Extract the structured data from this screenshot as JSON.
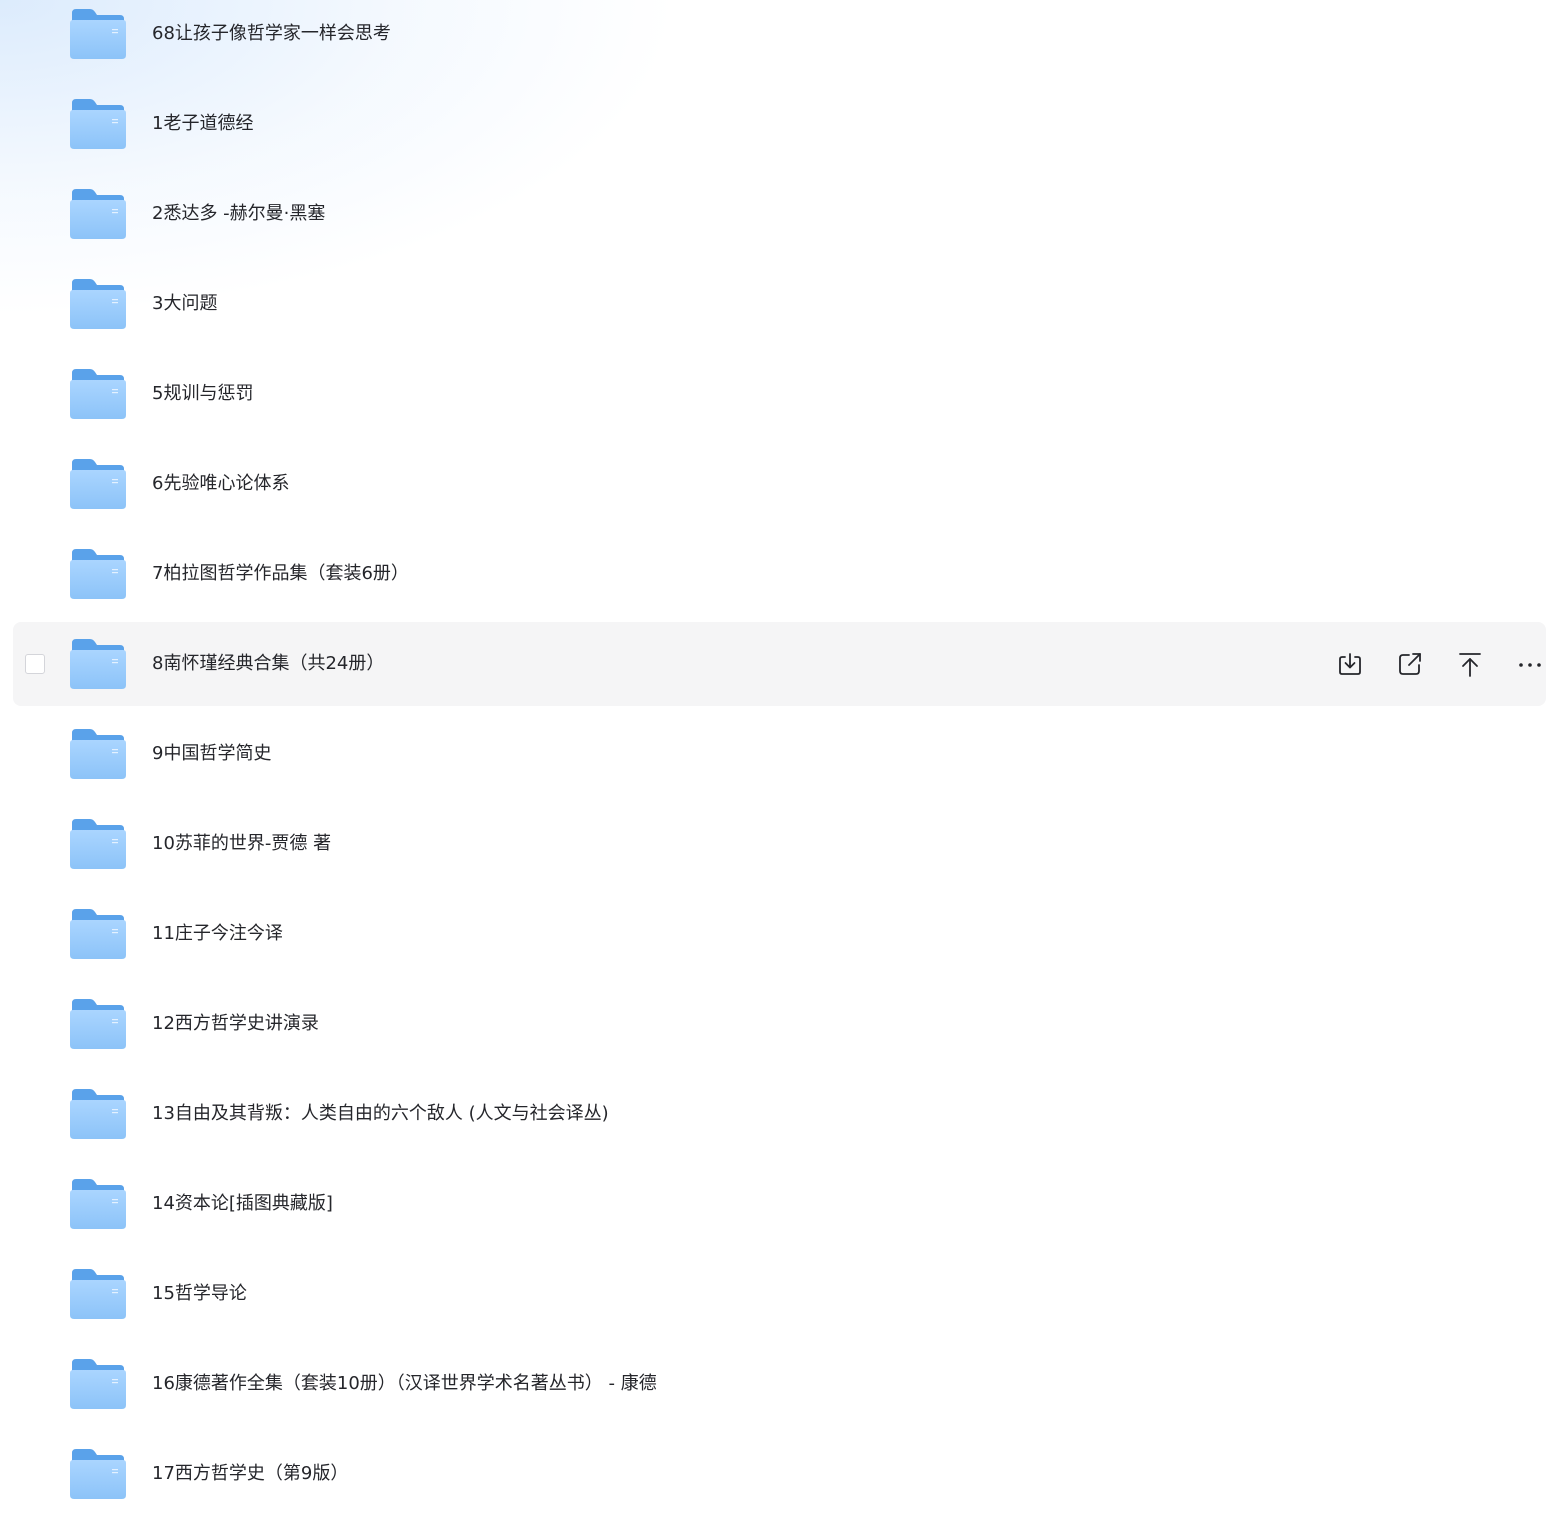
{
  "folders": [
    {
      "name": "68让孩子像哲学家一样会思考"
    },
    {
      "name": "1老子道德经"
    },
    {
      "name": "2悉达多 -赫尔曼·黑塞"
    },
    {
      "name": "3大问题"
    },
    {
      "name": "5规训与惩罚"
    },
    {
      "name": "6先验唯心论体系"
    },
    {
      "name": "7柏拉图哲学作品集（套装6册）"
    },
    {
      "name": "8南怀瑾经典合集（共24册）"
    },
    {
      "name": "9中国哲学简史"
    },
    {
      "name": "10苏菲的世界-贾德 著"
    },
    {
      "name": "11庄子今注今译"
    },
    {
      "name": "12西方哲学史讲演录"
    },
    {
      "name": "13自由及其背叛：人类自由的六个敌人 (人文与社会译丛)"
    },
    {
      "name": "14资本论[插图典藏版]"
    },
    {
      "name": "15哲学导论"
    },
    {
      "name": "16康德著作全集（套装10册）（汉译世界学术名著丛书） - 康德"
    },
    {
      "name": "17西方哲学史（第9版）"
    }
  ],
  "hovered_index": 7,
  "row_actions": [
    {
      "icon": "download-icon"
    },
    {
      "icon": "share-icon"
    },
    {
      "icon": "move-to-top-icon"
    },
    {
      "icon": "more-icon"
    }
  ],
  "colors": {
    "folder_back": "#5aa2ea",
    "folder_front_top": "#a9d4ff",
    "folder_front_bottom": "#86bff7",
    "hover_bg": "#f5f5f6",
    "text": "#25262b",
    "icon": "#25262b"
  }
}
